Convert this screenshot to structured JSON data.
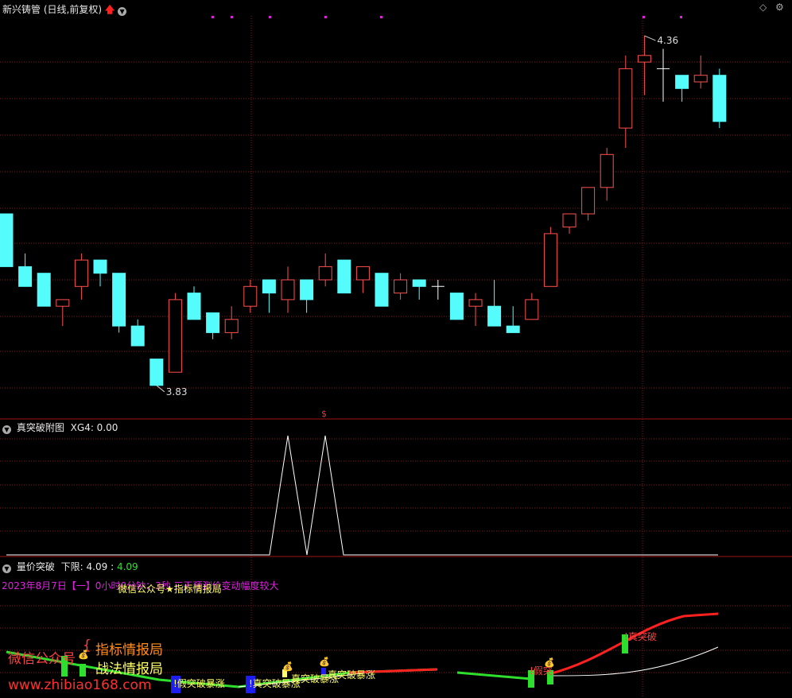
{
  "top_panel": {
    "title": "新兴铸管",
    "mode": "(日线,前复权)",
    "up_arrow": "🡅",
    "high_label": "4.36",
    "low_label": "3.83",
    "s_marker": "$"
  },
  "mid_panel": {
    "title": "真突破附图",
    "indicator": "XG4: 0.00"
  },
  "bottom_panel": {
    "title": "量价突破",
    "lower_label": "下限:",
    "lower_value1": "4.09",
    "lower_value2": "4.09",
    "date_line": "2023年8月7日【一】0小时0分钟：3秒   三天预测价变动幅度较大",
    "wechat_line": "微信公众号★指标情报局",
    "wm_left": "微信公众号",
    "wm_right1": "指标情报局",
    "wm_right2": "战法情报局",
    "wm_url": "www.zhibiao168.com",
    "label_fake1": "!假突破暴涨",
    "label_real1": "!真突破暴涨",
    "label_real2": "真突破暴涨",
    "label_real3": "真突破暴涨",
    "label_fake2": "!假突",
    "label_zhen": "!真突破",
    "bag_icon": "money-bag"
  },
  "colors": {
    "up": "#ff5050",
    "down": "#54fcfc",
    "grid": "#8b1414",
    "bg": "#000000"
  },
  "chart_data": {
    "type": "candlestick",
    "title": "新兴铸管 (日线,前复权)",
    "ylim": [
      3.79,
      4.39
    ],
    "annotations": {
      "high": 4.36,
      "low": 3.83
    },
    "candles": [
      {
        "o": 4.09,
        "h": 4.09,
        "l": 4.01,
        "c": 4.01
      },
      {
        "o": 4.01,
        "h": 4.03,
        "l": 3.98,
        "c": 3.98
      },
      {
        "o": 4.0,
        "h": 4.0,
        "l": 3.95,
        "c": 3.95
      },
      {
        "o": 3.95,
        "h": 3.96,
        "l": 3.92,
        "c": 3.96
      },
      {
        "o": 3.98,
        "h": 4.03,
        "l": 3.96,
        "c": 4.02
      },
      {
        "o": 4.02,
        "h": 4.02,
        "l": 3.98,
        "c": 4.0
      },
      {
        "o": 4.0,
        "h": 4.0,
        "l": 3.91,
        "c": 3.92
      },
      {
        "o": 3.92,
        "h": 3.93,
        "l": 3.89,
        "c": 3.89
      },
      {
        "o": 3.87,
        "h": 3.87,
        "l": 3.83,
        "c": 3.83
      },
      {
        "o": 3.85,
        "h": 3.97,
        "l": 3.85,
        "c": 3.96
      },
      {
        "o": 3.97,
        "h": 3.98,
        "l": 3.93,
        "c": 3.93
      },
      {
        "o": 3.94,
        "h": 3.94,
        "l": 3.9,
        "c": 3.91
      },
      {
        "o": 3.91,
        "h": 3.95,
        "l": 3.9,
        "c": 3.93
      },
      {
        "o": 3.95,
        "h": 3.99,
        "l": 3.94,
        "c": 3.98
      },
      {
        "o": 3.99,
        "h": 3.99,
        "l": 3.94,
        "c": 3.97
      },
      {
        "o": 3.96,
        "h": 4.01,
        "l": 3.94,
        "c": 3.99
      },
      {
        "o": 3.99,
        "h": 3.99,
        "l": 3.94,
        "c": 3.96
      },
      {
        "o": 3.99,
        "h": 4.03,
        "l": 3.98,
        "c": 4.01
      },
      {
        "o": 4.02,
        "h": 4.02,
        "l": 3.97,
        "c": 3.97
      },
      {
        "o": 3.99,
        "h": 4.01,
        "l": 3.97,
        "c": 4.01
      },
      {
        "o": 4.0,
        "h": 4.0,
        "l": 3.95,
        "c": 3.95
      },
      {
        "o": 3.97,
        "h": 4.0,
        "l": 3.96,
        "c": 3.99
      },
      {
        "o": 3.99,
        "h": 3.99,
        "l": 3.96,
        "c": 3.98
      },
      {
        "o": 3.98,
        "h": 3.99,
        "l": 3.96,
        "c": 3.98
      },
      {
        "o": 3.97,
        "h": 3.97,
        "l": 3.93,
        "c": 3.93
      },
      {
        "o": 3.95,
        "h": 3.97,
        "l": 3.92,
        "c": 3.96
      },
      {
        "o": 3.95,
        "h": 3.99,
        "l": 3.92,
        "c": 3.92
      },
      {
        "o": 3.92,
        "h": 3.95,
        "l": 3.91,
        "c": 3.91
      },
      {
        "o": 3.93,
        "h": 3.97,
        "l": 3.93,
        "c": 3.96
      },
      {
        "o": 3.98,
        "h": 4.07,
        "l": 3.98,
        "c": 4.06
      },
      {
        "o": 4.07,
        "h": 4.09,
        "l": 4.06,
        "c": 4.09
      },
      {
        "o": 4.09,
        "h": 4.13,
        "l": 4.08,
        "c": 4.13
      },
      {
        "o": 4.13,
        "h": 4.19,
        "l": 4.11,
        "c": 4.18
      },
      {
        "o": 4.22,
        "h": 4.33,
        "l": 4.19,
        "c": 4.31
      },
      {
        "o": 4.32,
        "h": 4.36,
        "l": 4.27,
        "c": 4.33
      },
      {
        "o": 4.31,
        "h": 4.34,
        "l": 4.26,
        "c": 4.31
      },
      {
        "o": 4.3,
        "h": 4.3,
        "l": 4.26,
        "c": 4.28
      },
      {
        "o": 4.29,
        "h": 4.33,
        "l": 4.28,
        "c": 4.3
      },
      {
        "o": 4.3,
        "h": 4.31,
        "l": 4.22,
        "c": 4.23
      }
    ],
    "xg4": [
      0,
      0,
      0,
      0,
      0,
      0,
      0,
      0,
      0,
      0,
      0,
      0,
      0,
      0,
      0,
      1,
      0,
      1,
      0,
      0,
      0,
      0,
      0,
      0,
      0,
      0,
      0,
      0,
      0,
      0,
      0,
      0,
      0,
      0,
      0,
      0,
      0,
      0
    ]
  }
}
